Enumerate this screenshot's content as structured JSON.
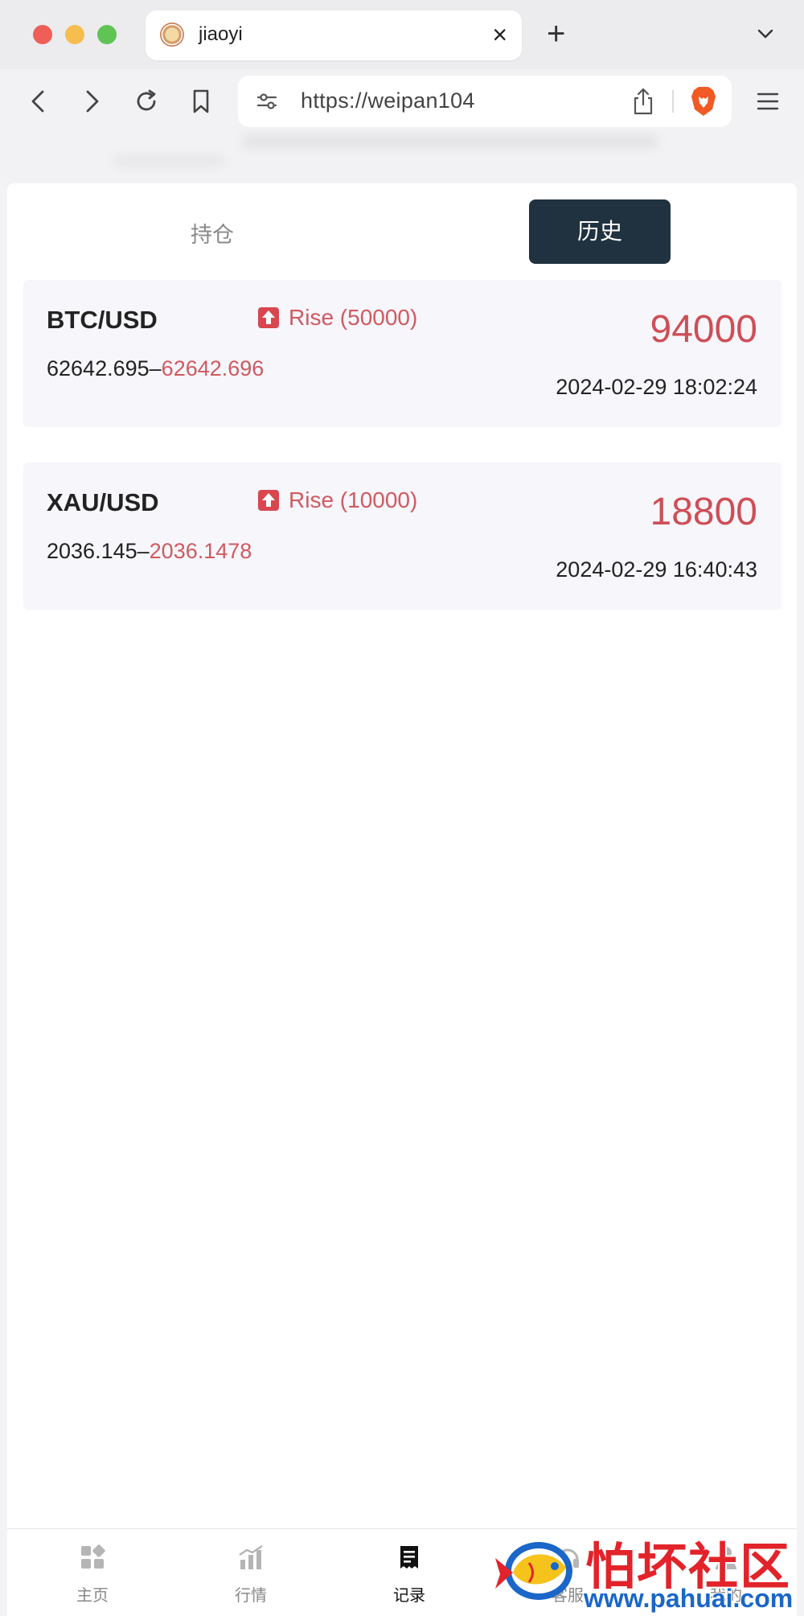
{
  "browser": {
    "tab_title": "jiaoyi",
    "url": "https://weipan104"
  },
  "tabs": {
    "holdings_label": "持仓",
    "history_label": "历史"
  },
  "records": [
    {
      "symbol": "BTC/USD",
      "direction": "Rise (50000)",
      "open_price": "62642.695",
      "separator": "–",
      "close_price": "62642.696",
      "amount": "94000",
      "time": "2024-02-29 18:02:24"
    },
    {
      "symbol": "XAU/USD",
      "direction": "Rise (10000)",
      "open_price": "2036.145",
      "separator": "–",
      "close_price": "2036.1478",
      "amount": "18800",
      "time": "2024-02-29 16:40:43"
    }
  ],
  "bottom_nav": {
    "home": "主页",
    "market": "行情",
    "records": "记录",
    "service": "客服",
    "mine": "我的"
  },
  "watermark": {
    "title": "怕坏社区",
    "url": "www.pahuai.com"
  },
  "colors": {
    "accent_red": "#cf4e56",
    "active_tab_bg": "#203240",
    "card_bg": "#f6f6fb"
  }
}
